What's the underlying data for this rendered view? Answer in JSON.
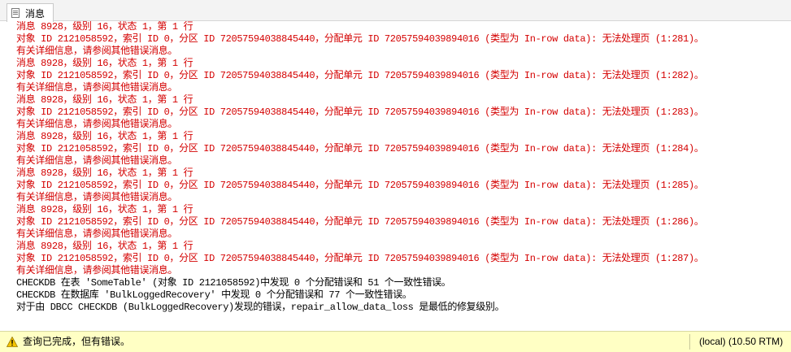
{
  "tab": {
    "label": "消息",
    "icon": "message-document-icon"
  },
  "messages": [
    {
      "text": "消息 8928，级别 16，状态 1，第 1 行",
      "kind": "err"
    },
    {
      "text": "对象 ID 2121058592，索引 ID 0，分区 ID 72057594038845440，分配单元 ID 72057594039894016 (类型为 In-row data): 无法处理页 (1:281)。",
      "kind": "err"
    },
    {
      "text": "有关详细信息，请参阅其他错误消息。",
      "kind": "err"
    },
    {
      "text": "消息 8928，级别 16，状态 1，第 1 行",
      "kind": "err"
    },
    {
      "text": "对象 ID 2121058592，索引 ID 0，分区 ID 72057594038845440，分配单元 ID 72057594039894016 (类型为 In-row data): 无法处理页 (1:282)。",
      "kind": "err"
    },
    {
      "text": "有关详细信息，请参阅其他错误消息。",
      "kind": "err"
    },
    {
      "text": "消息 8928，级别 16，状态 1，第 1 行",
      "kind": "err"
    },
    {
      "text": "对象 ID 2121058592，索引 ID 0，分区 ID 72057594038845440，分配单元 ID 72057594039894016 (类型为 In-row data): 无法处理页 (1:283)。",
      "kind": "err"
    },
    {
      "text": "有关详细信息，请参阅其他错误消息。",
      "kind": "err"
    },
    {
      "text": "消息 8928，级别 16，状态 1，第 1 行",
      "kind": "err"
    },
    {
      "text": "对象 ID 2121058592，索引 ID 0，分区 ID 72057594038845440，分配单元 ID 72057594039894016 (类型为 In-row data): 无法处理页 (1:284)。",
      "kind": "err"
    },
    {
      "text": "有关详细信息，请参阅其他错误消息。",
      "kind": "err"
    },
    {
      "text": "消息 8928，级别 16，状态 1，第 1 行",
      "kind": "err"
    },
    {
      "text": "对象 ID 2121058592，索引 ID 0，分区 ID 72057594038845440，分配单元 ID 72057594039894016 (类型为 In-row data): 无法处理页 (1:285)。",
      "kind": "err"
    },
    {
      "text": "有关详细信息，请参阅其他错误消息。",
      "kind": "err"
    },
    {
      "text": "消息 8928，级别 16，状态 1，第 1 行",
      "kind": "err"
    },
    {
      "text": "对象 ID 2121058592，索引 ID 0，分区 ID 72057594038845440，分配单元 ID 72057594039894016 (类型为 In-row data): 无法处理页 (1:286)。",
      "kind": "err"
    },
    {
      "text": "有关详细信息，请参阅其他错误消息。",
      "kind": "err"
    },
    {
      "text": "消息 8928，级别 16，状态 1，第 1 行",
      "kind": "err"
    },
    {
      "text": "对象 ID 2121058592，索引 ID 0，分区 ID 72057594038845440，分配单元 ID 72057594039894016 (类型为 In-row data): 无法处理页 (1:287)。",
      "kind": "err"
    },
    {
      "text": "有关详细信息，请参阅其他错误消息。",
      "kind": "err"
    },
    {
      "text": "CHECKDB 在表 'SomeTable' (对象 ID 2121058592)中发现 0 个分配错误和 51 个一致性错误。",
      "kind": "info"
    },
    {
      "text": "CHECKDB 在数据库 'BulkLoggedRecovery' 中发现 0 个分配错误和 77 个一致性错误。",
      "kind": "info"
    },
    {
      "text": "对于由 DBCC CHECKDB (BulkLoggedRecovery)发现的错误，repair_allow_data_loss 是最低的修复级别。",
      "kind": "info"
    }
  ],
  "colors": {
    "error_text": "#d40000",
    "info_text": "#000000",
    "status_bg": "#ffffc4"
  },
  "status": {
    "icon": "warning-icon",
    "text": "查询已完成，但有错误。",
    "server": "(local) (10.50 RTM)"
  }
}
